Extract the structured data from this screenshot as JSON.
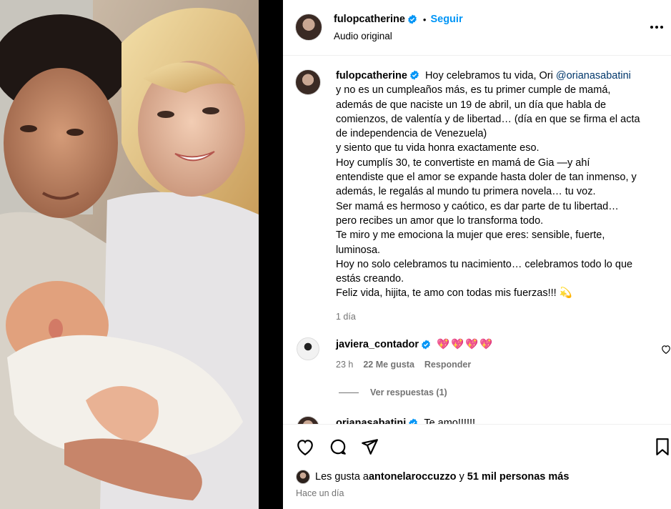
{
  "post": {
    "author": "fulopcatherine",
    "follow_label": "Seguir",
    "separator": "•",
    "audio": "Audio original",
    "more_icon": "more-horizontal-icon"
  },
  "caption": {
    "author": "fulopcatherine",
    "first_line_text": "Hoy celebramos tu vida, Ori ",
    "mention": "@orianasabatini",
    "lines": [
      "y no es un cumpleaños más, es tu primer cumple de mamá,",
      "además de que naciste un 19 de abril, un día que habla de",
      "comienzos, de valentía y de libertad… (día en que se firma el acta",
      "de independencia de Venezuela)",
      "y siento que tu vida honra exactamente eso.",
      "Hoy cumplís 30, te convertiste en mamá de Gia —y ahí",
      "entendiste que el amor se expande hasta doler de tan inmenso, y",
      "además, le regalás al mundo tu primera novela… tu voz.",
      "Ser mamá es hermoso y caótico, es dar parte de tu libertad…",
      "pero recibes un amor que lo transforma todo.",
      "Te miro y me emociona la mujer que eres: sensible, fuerte,",
      "luminosa.",
      "Hoy no solo celebramos tu nacimiento… celebramos todo lo que",
      "estás creando.",
      "Feliz vida, hijita, te amo con todas mis fuerzas!!! 💫"
    ],
    "time": "1 día"
  },
  "comments": [
    {
      "author": "javiera_contador",
      "text": "💖💖💖💖",
      "time": "23 h",
      "likes": "22 Me gusta",
      "reply_label": "Responder",
      "view_replies": "Ver respuestas (1)"
    }
  ],
  "partial_comment": {
    "author": "orianasabatini",
    "text": "Te amo!!!!!!"
  },
  "footer": {
    "likes_prefix": "Les gusta a ",
    "likes_user": "antonelaroccuzzo",
    "likes_middle": " y ",
    "likes_count": "51 mil personas más",
    "posted": "Hace un día"
  },
  "colors": {
    "link": "#0095f6",
    "mention": "#00376b",
    "muted": "#737373",
    "verified": "#0095f6"
  }
}
